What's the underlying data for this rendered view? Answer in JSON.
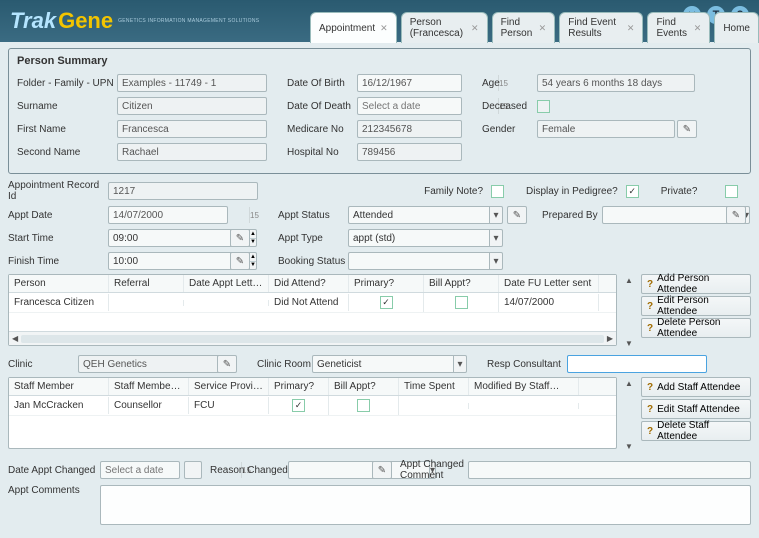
{
  "header": {
    "logo_trak": "Trak",
    "logo_gene": "Gene",
    "logo_tag": "GENETICS INFORMATION MANAGEMENT SOLUTIONS",
    "icons": {
      "close": "✕",
      "info": "T",
      "help": "?"
    }
  },
  "tabs": [
    {
      "label": "Appointment",
      "active": true,
      "closable": true
    },
    {
      "label": "Person (Francesca)",
      "active": false,
      "closable": true
    },
    {
      "label": "Find Person",
      "active": false,
      "closable": true
    },
    {
      "label": "Find Event Results",
      "active": false,
      "closable": true
    },
    {
      "label": "Find Events",
      "active": false,
      "closable": true
    },
    {
      "label": "Home",
      "active": false,
      "closable": false
    }
  ],
  "summary": {
    "title": "Person Summary",
    "labels": {
      "folder": "Folder - Family - UPN",
      "surname": "Surname",
      "first_name": "First Name",
      "second_name": "Second Name",
      "dob": "Date Of Birth",
      "dod": "Date Of Death",
      "medicare": "Medicare No",
      "hospital": "Hospital No",
      "age": "Age",
      "deceased": "Deceased",
      "gender": "Gender"
    },
    "values": {
      "folder": "Examples - 11749 - 1",
      "surname": "Citizen",
      "first_name": "Francesca",
      "second_name": "Rachael",
      "dob": "16/12/1967",
      "dod_placeholder": "Select a date",
      "medicare": "212345678",
      "hospital": "789456",
      "age": "54 years 6 months 18 days",
      "deceased": false,
      "gender": "Female"
    }
  },
  "appointment": {
    "labels": {
      "record_id": "Appointment Record Id",
      "family_note": "Family Note?",
      "display_pedigree": "Display in Pedigree?",
      "private": "Private?",
      "appt_date": "Appt Date",
      "start_time": "Start Time",
      "finish_time": "Finish Time",
      "appt_status": "Appt Status",
      "appt_type": "Appt Type",
      "booking_status": "Booking Status",
      "prepared_by": "Prepared By"
    },
    "values": {
      "record_id": "1217",
      "family_note": false,
      "display_pedigree": true,
      "private": false,
      "appt_date": "14/07/2000",
      "start_time": "09:00",
      "finish_time": "10:00",
      "appt_status": "Attended",
      "appt_type": "appt (std)",
      "booking_status": "",
      "prepared_by": ""
    }
  },
  "attendee_grid": {
    "headers": [
      "Person",
      "Referral",
      "Date Appt Letter s…",
      "Did Attend?",
      "Primary?",
      "Bill Appt?",
      "Date FU Letter sent"
    ],
    "row": {
      "person": "Francesca Citizen",
      "referral": "",
      "date_letter_sent": "",
      "did_attend": "Did Not Attend",
      "primary": true,
      "bill_appt": false,
      "date_fu": "14/07/2000"
    },
    "buttons": {
      "add": "Add Person Attendee",
      "edit": "Edit Person Attendee",
      "delete": "Delete Person Attendee"
    }
  },
  "clinic": {
    "labels": {
      "clinic": "Clinic",
      "room": "Clinic Room",
      "resp": "Resp Consultant"
    },
    "values": {
      "clinic": "QEH Genetics",
      "room": "Geneticist",
      "resp": ""
    }
  },
  "staff_grid": {
    "headers": [
      "Staff Member",
      "Staff Member Role",
      "Service Provider",
      "Primary?",
      "Bill Appt?",
      "Time Spent",
      "Modified By Staff…"
    ],
    "row": {
      "staff": "Jan McCracken",
      "role": "Counsellor",
      "provider": "FCU",
      "primary": true,
      "bill_appt": false,
      "time_spent": "",
      "modified_by": ""
    },
    "buttons": {
      "add": "Add Staff Attendee",
      "edit": "Edit Staff Attendee",
      "delete": "Delete Staff Attendee"
    }
  },
  "footer": {
    "labels": {
      "date_changed": "Date Appt Changed",
      "date_changed_placeholder": "Select a date",
      "reason_changed": "Reason Changed",
      "changed_comment": "Appt Changed Comment",
      "appt_comments": "Appt Comments"
    },
    "values": {
      "date_changed": "",
      "reason_changed": "",
      "changed_comment": "",
      "appt_comments": ""
    }
  },
  "glyphs": {
    "q": "?",
    "pencil": "✎",
    "cal": "15",
    "up": "▲",
    "down": "▼",
    "left": "◀",
    "right": "▶",
    "check": "✓",
    "dd": "▾"
  }
}
